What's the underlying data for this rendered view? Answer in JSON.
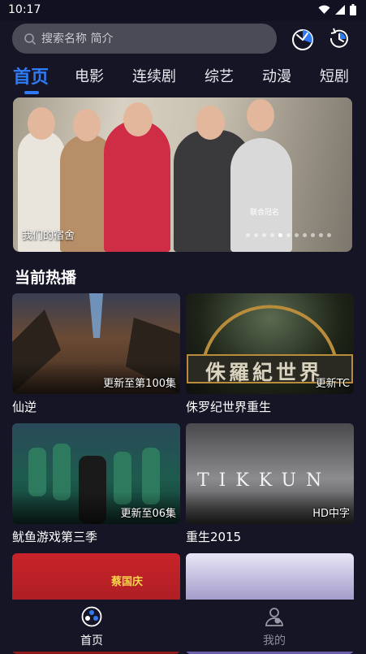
{
  "status_bar": {
    "time": "10:17"
  },
  "search": {
    "placeholder": "搜索名称 简介"
  },
  "tabs": [
    {
      "label": "首页",
      "active": true
    },
    {
      "label": "电影",
      "active": false
    },
    {
      "label": "连续剧",
      "active": false
    },
    {
      "label": "综艺",
      "active": false
    },
    {
      "label": "动漫",
      "active": false
    },
    {
      "label": "短剧",
      "active": false
    }
  ],
  "banner": {
    "caption": "我们的宿舍",
    "sponsor_text": "联合冠名",
    "slide_count": 11,
    "active_slide": 4
  },
  "section": {
    "title": "当前热播"
  },
  "cards": [
    {
      "title": "仙逆",
      "badge": "更新至第100集"
    },
    {
      "title": "侏罗纪世界重生",
      "badge": "更新TC",
      "poster_text": "侏羅紀世界"
    },
    {
      "title": "鱿鱼游戏第三季",
      "badge": "更新至06集"
    },
    {
      "title": "重生2015",
      "badge": "HD中字",
      "poster_text": "TIKKUN"
    },
    {
      "title": "",
      "badge": "",
      "poster_text": "蔡国庆"
    },
    {
      "title": "",
      "badge": ""
    }
  ],
  "bottom_nav": [
    {
      "label": "首页",
      "active": true
    },
    {
      "label": "我的",
      "active": false
    }
  ],
  "colors": {
    "accent": "#2f7bf5",
    "background": "#151526",
    "search_bg": "#4b4b57"
  }
}
